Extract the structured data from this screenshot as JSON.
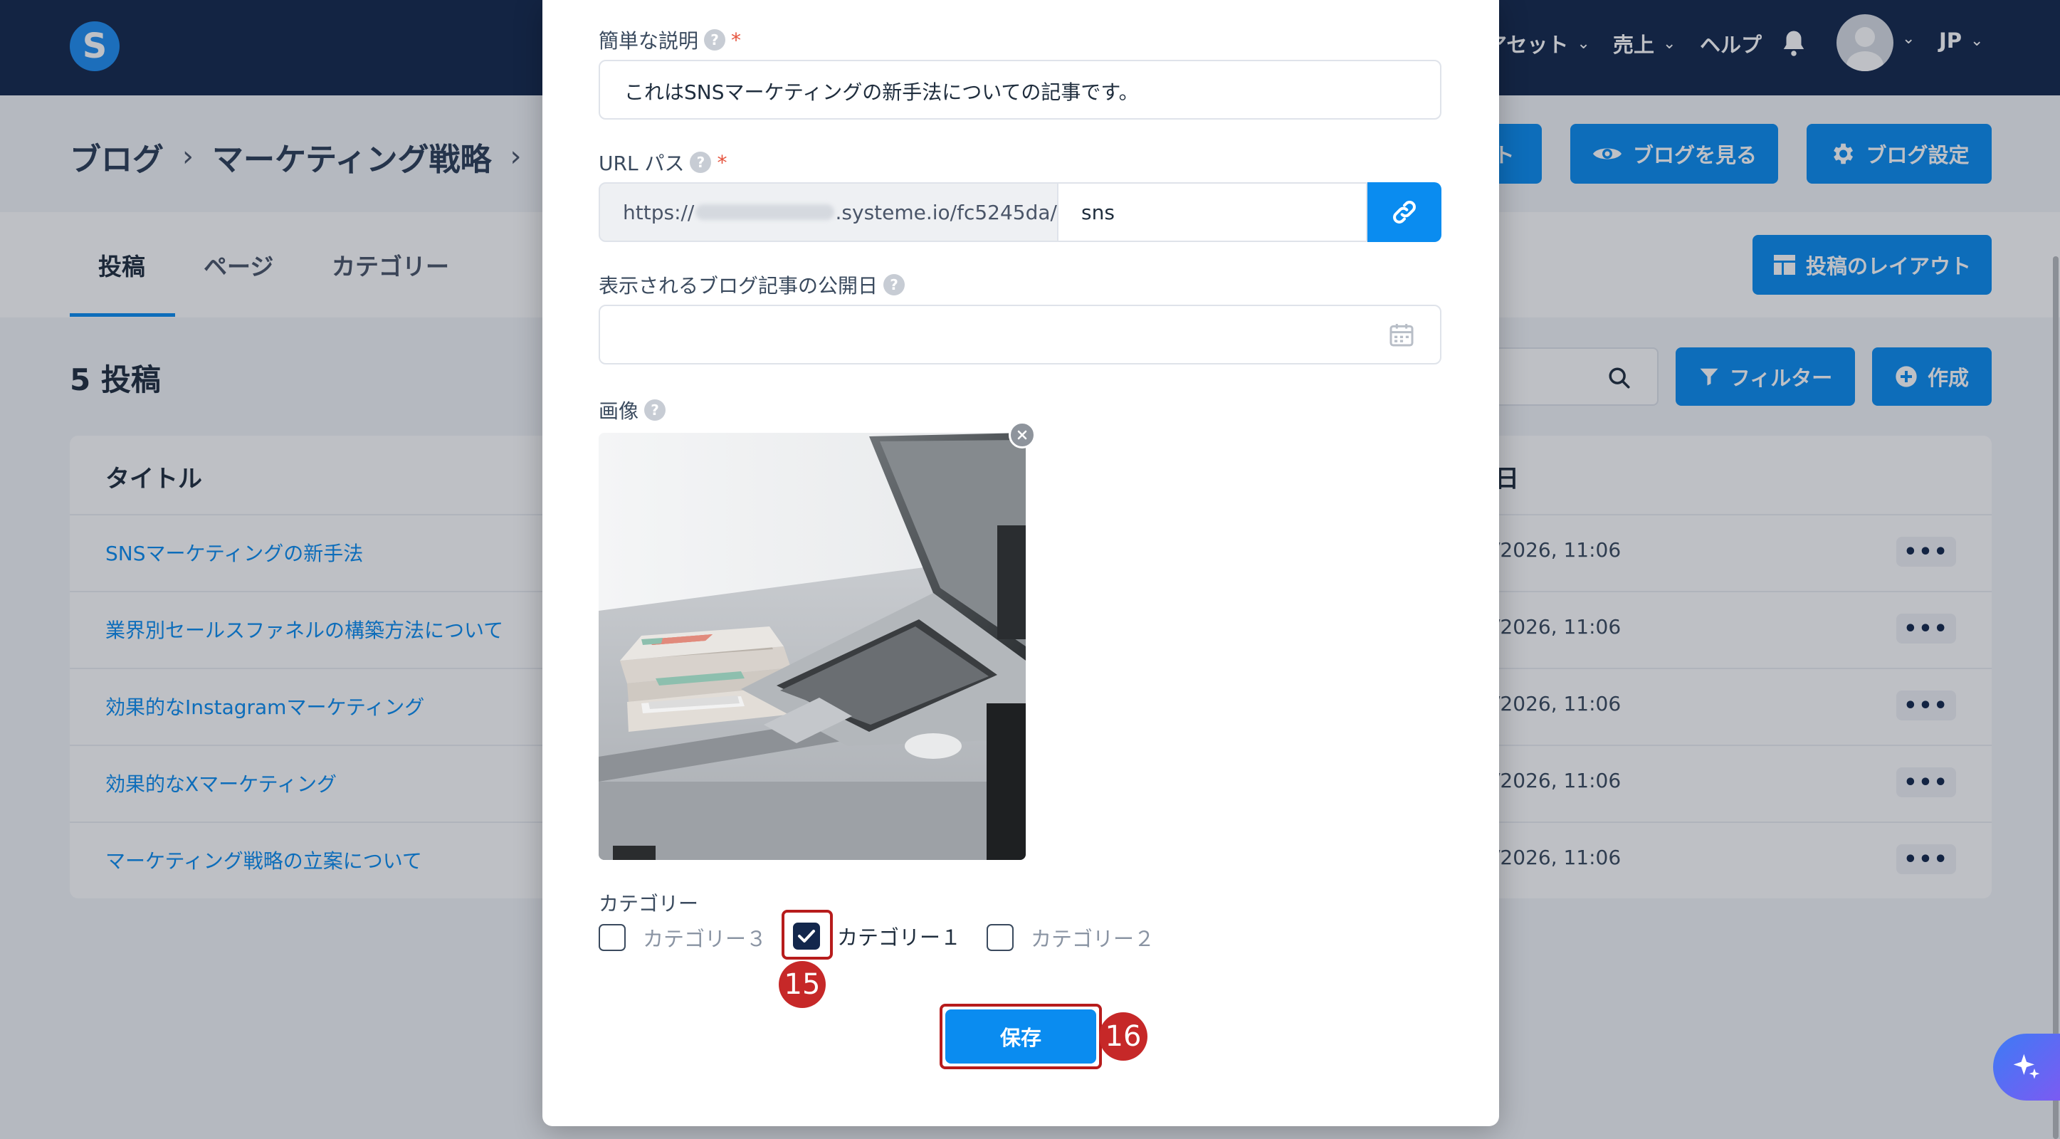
{
  "topbar": {
    "logo": "S",
    "nav": [
      "アセット",
      "売上",
      "ヘルプ"
    ],
    "language": "JP"
  },
  "page": {
    "breadcrumb": [
      "ブログ",
      "マーケティング戦略"
    ],
    "buttons": {
      "partial": "ト",
      "view_blog": "ブログを見る",
      "blog_settings": "ブログ設定",
      "post_layout": "投稿のレイアウト",
      "filter": "フィルター",
      "create": "作成"
    },
    "tabs": [
      "投稿",
      "ページ",
      "カテゴリー"
    ],
    "post_count": "5 投稿",
    "table": {
      "col_title": "タイトル",
      "col_date": "日",
      "rows": [
        {
          "title": "SNSマーケティングの新手法",
          "date": "/2026, 11:06"
        },
        {
          "title": "業界別セールスファネルの構築方法について",
          "date": "/2026, 11:06"
        },
        {
          "title": "効果的なInstagramマーケティング",
          "date": "/2026, 11:06"
        },
        {
          "title": "効果的なXマーケティング",
          "date": "/2026, 11:06"
        },
        {
          "title": "マーケティング戦略の立案について",
          "date": "/2026, 11:06"
        }
      ],
      "row_menu": "•••"
    }
  },
  "modal": {
    "description_label": "簡単な説明",
    "description_value": "これはSNSマーケティングの新手法についての記事です。",
    "url_label": "URL パス",
    "url_prefix_start": "https://",
    "url_prefix_end": ".systeme.io/fc5245da/",
    "url_slug": "sns",
    "publish_date_label": "表示されるブログ記事の公開日",
    "publish_date_value": "",
    "image_label": "画像",
    "category_label": "カテゴリー",
    "categories": [
      {
        "label": "カテゴリー３",
        "checked": false
      },
      {
        "label": "カテゴリー１",
        "checked": true
      },
      {
        "label": "カテゴリー２",
        "checked": false
      }
    ],
    "save_label": "保存",
    "required_mark": "*",
    "help_mark": "?"
  },
  "annotations": {
    "step_checkbox": "15",
    "step_save": "16"
  },
  "colors": {
    "topbar": "#13274c",
    "primary": "#0a8cf0",
    "annotation": "#c62828",
    "link": "#0a8cf0"
  }
}
